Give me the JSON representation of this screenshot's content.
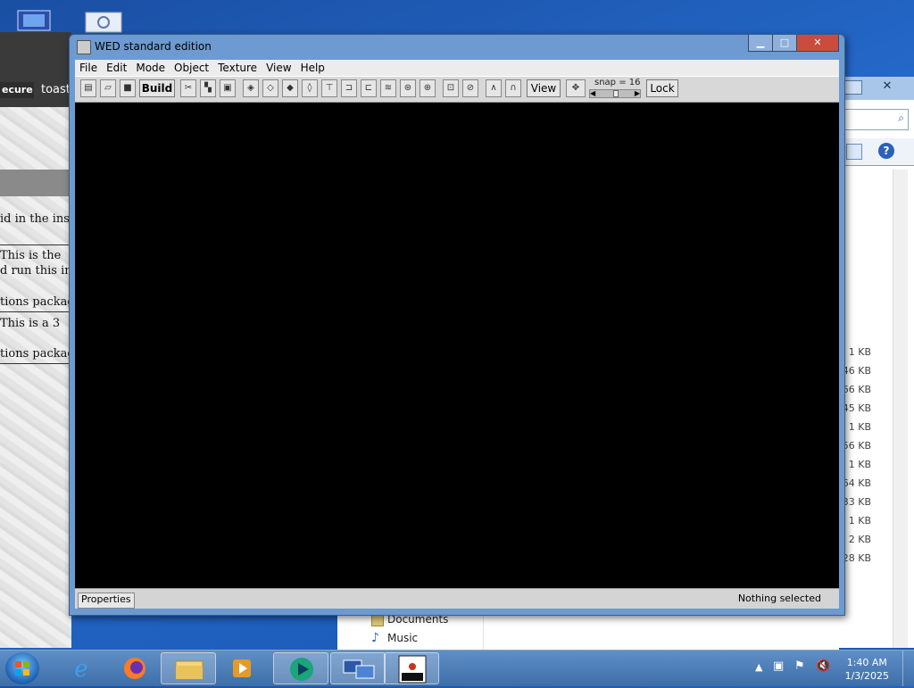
{
  "background_browser": {
    "secure_label": "ecure",
    "tab_text": "toast",
    "lines": [
      "id in the ins",
      "This is the",
      "d run this in",
      "tions packag",
      "This is a 3",
      "tions packag"
    ]
  },
  "background_explorer": {
    "sizes": [
      "1 KB",
      "46 KB",
      "66 KB",
      "45 KB",
      "1 KB",
      "56 KB",
      "1 KB",
      "64 KB",
      "33 KB",
      "1 KB",
      "2 KB",
      "28 KB"
    ],
    "nav_items": [
      {
        "label": "Documents",
        "icon": "documents-icon"
      },
      {
        "label": "Music",
        "icon": "music-icon"
      }
    ]
  },
  "wed_window": {
    "title": "WED standard edition",
    "menu": [
      "File",
      "Edit",
      "Mode",
      "Object",
      "Texture",
      "View",
      "Help"
    ],
    "toolbar": {
      "build_label": "Build",
      "view_label": "View",
      "lock_label": "Lock",
      "snap_label": "snap = 16"
    },
    "status": {
      "properties_label": "Properties",
      "selection_text": "Nothing selected"
    }
  },
  "taskbar": {
    "clock_time": "1:40 AM",
    "clock_date": "1/3/2025",
    "pinned": [
      "internet-explorer",
      "firefox",
      "file-explorer",
      "media-player",
      "app-green",
      "remote-desktop",
      "wed-app"
    ]
  },
  "colors": {
    "desktop": "#1f5cb8",
    "canvas": "#000000",
    "titlebar": "#6d9ad0",
    "close_button": "#c94c3c"
  }
}
